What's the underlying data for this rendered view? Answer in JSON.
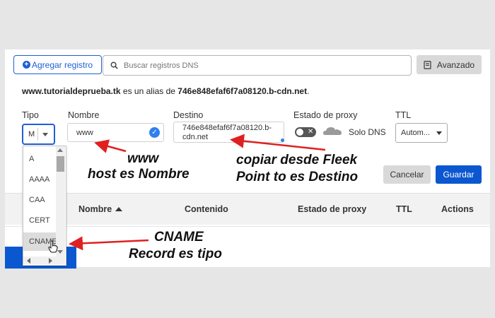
{
  "toolbar": {
    "add_label": "Agregar registro",
    "search_placeholder": "Buscar registros DNS",
    "advanced_label": "Avanzado"
  },
  "alias": {
    "domain": "www.tutorialdeprueba.tk",
    "middle": " es un alias de ",
    "target": "746e848efaf6f7a08120.b-cdn.net",
    "end": "."
  },
  "form": {
    "tipo_label": "Tipo",
    "nombre_label": "Nombre",
    "destino_label": "Destino",
    "proxy_label": "Estado de proxy",
    "ttl_label": "TTL",
    "tipo_value": "M",
    "nombre_value": "www",
    "destino_line1": "746e848efaf6f7a08120.b-",
    "destino_line2": "cdn.net",
    "proxy_value": "Solo DNS",
    "ttl_value": "Autom...",
    "cancel_label": "Cancelar",
    "save_label": "Guardar"
  },
  "table": {
    "columns": [
      "Nombre",
      "Contenido",
      "Estado de proxy",
      "TTL",
      "Actions"
    ]
  },
  "dropdown": {
    "options": [
      "A",
      "AAAA",
      "CAA",
      "CERT",
      "CNAME"
    ]
  },
  "annotations": {
    "www_line1": "www",
    "www_line2": "host es Nombre",
    "fleek_line1": "copiar desde Fleek",
    "fleek_line2": "Point to es Destino",
    "cname_line1": "CNAME",
    "cname_line2": "Record es tipo"
  },
  "colors": {
    "accent": "#1f5fd6",
    "save": "#0b57d0",
    "arrow": "#e02020"
  }
}
